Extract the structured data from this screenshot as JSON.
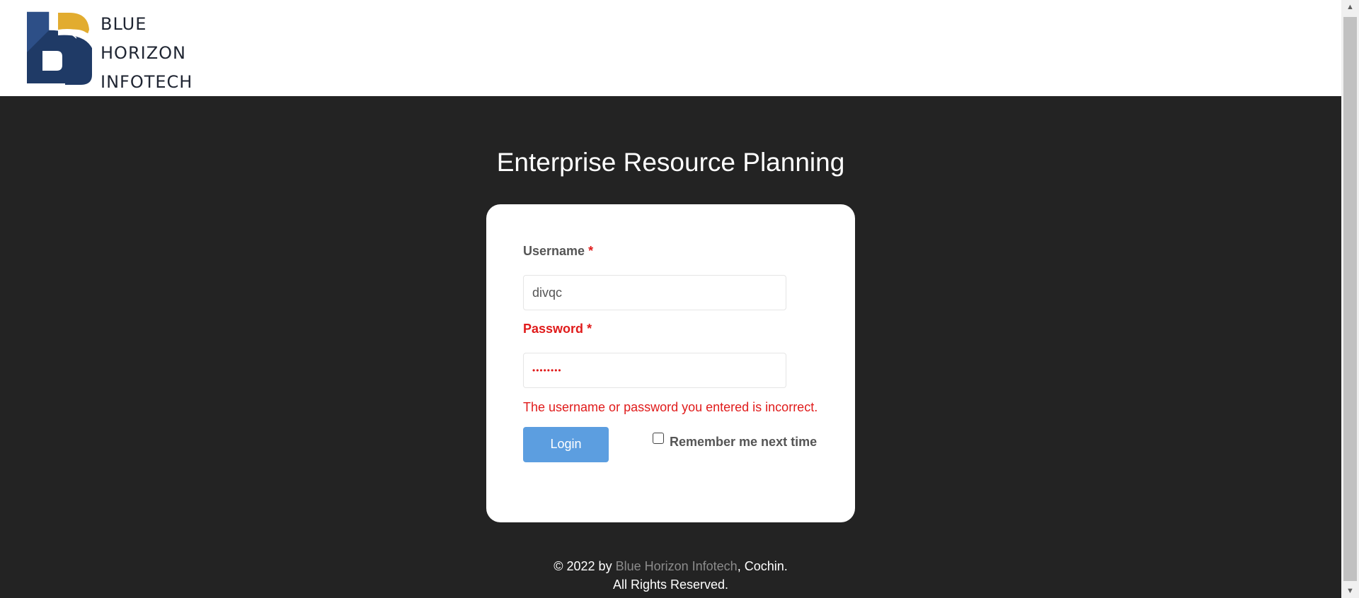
{
  "header": {
    "logo_lines": [
      "BLUE",
      "HORIZON",
      "INFOTECH"
    ]
  },
  "main": {
    "title": "Enterprise Resource Planning"
  },
  "form": {
    "username_label": "Username",
    "username_required": "*",
    "username_value": "divqc",
    "password_label": "Password",
    "password_required": "*",
    "password_value": "••••••••",
    "error_message": "The username or password you entered is incorrect.",
    "login_label": "Login",
    "remember_label": "Remember me next time",
    "remember_checked": false
  },
  "footer": {
    "line1_prefix": "© 2022 by ",
    "line1_link": "Blue Horizon Infotech",
    "line1_suffix": ", Cochin.",
    "line2": "All Rights Reserved."
  },
  "colors": {
    "background": "#232323",
    "error": "#e01b1b",
    "button": "#5c9ee0",
    "logo_navy": "#1f3a66",
    "logo_gold": "#e2ac2f"
  },
  "icons": {
    "scroll_up": "▲",
    "scroll_down": "▼"
  }
}
